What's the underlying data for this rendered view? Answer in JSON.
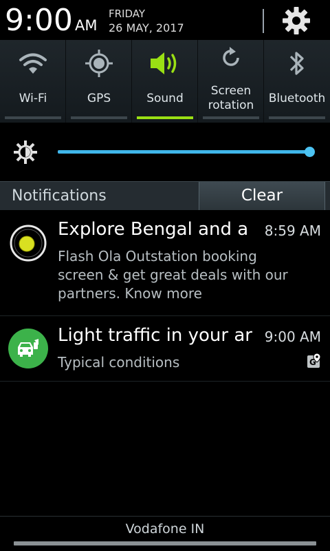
{
  "status": {
    "time": "9:00",
    "ampm": "AM",
    "day": "FRIDAY",
    "date": "26 MAY, 2017"
  },
  "quick_settings": [
    {
      "label": "Wi-Fi",
      "icon": "wifi-icon",
      "active": false
    },
    {
      "label": "GPS",
      "icon": "gps-icon",
      "active": false
    },
    {
      "label": "Sound",
      "icon": "sound-icon",
      "active": true
    },
    {
      "label": "Screen\nrotation",
      "icon": "rotation-icon",
      "active": false
    },
    {
      "label": "Bluetooth",
      "icon": "bluetooth-icon",
      "active": false
    }
  ],
  "brightness": {
    "level": 1.0
  },
  "notifications_header": {
    "title": "Notifications",
    "clear_label": "Clear"
  },
  "notifications": [
    {
      "title": "Explore Bengal and a",
      "time": "8:59 AM",
      "body": "Flash Ola Outstation booking screen & get great deals with our partners. Know more",
      "icon": "ola-icon"
    },
    {
      "title": "Light traffic in your ar",
      "time": "9:00 AM",
      "body": "Typical conditions",
      "icon": "traffic-car-icon"
    }
  ],
  "footer": {
    "carrier": "Vodafone IN"
  },
  "colors": {
    "accent_green": "#9ae014",
    "slider_blue": "#40b6ea",
    "traffic_green": "#3cb24a"
  }
}
